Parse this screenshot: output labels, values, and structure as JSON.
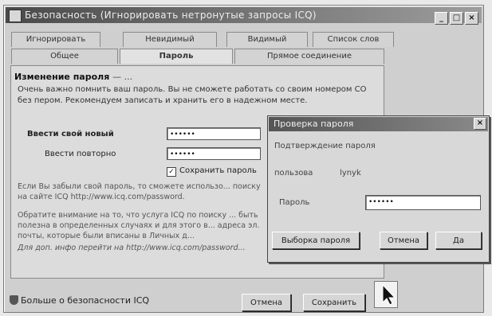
{
  "window": {
    "title": "Безопасность (Игнорировать нетронутые запросы ICQ)",
    "controls": [
      "_",
      "□",
      "×"
    ]
  },
  "tabs_top": [
    "Игнорировать",
    "Невидимый",
    "Видимый",
    "Список слов"
  ],
  "tabs_bottom": [
    "Общее",
    "Пароль",
    "Прямое соединение"
  ],
  "password_section": {
    "title": "Изменение пароля",
    "title_suffix": "— ...",
    "warning": "Очень важно помнить ваш пароль. Вы не сможете работать со своим номером СО без пером. Рекомендуем записать и хранить его в надежном месте.",
    "new_label": "Ввести свой новый",
    "repeat_label": "Ввести повторно",
    "new_value": "••••••",
    "repeat_value": "••••••",
    "save_password_label": "Сохранить пароль",
    "save_password_checked": true,
    "info_forgot": "Если Вы забыли свой пароль, то сможете использо... поиску на сайте ICQ http://www.icq.com/password.",
    "info_attention": "Обратите внимание на то, что услуга ICQ по поиску ... быть полезна в определенных случаях и для этого в... адреса эл. почты, которые были вписаны в Личных д...",
    "info_more": "Для доп. инфо перейти на http://www.icq.com/password..."
  },
  "footer": {
    "more_security_label": "Больше о безопасности ICQ",
    "cancel_label": "Отмена",
    "save_label": "Сохранить"
  },
  "dialog": {
    "title": "Проверка пароля",
    "close": "×",
    "subtitle": "Подтверждение пароля",
    "user_label": "пользова",
    "user_value": "lynyk",
    "password_label": "Пароль",
    "password_value": "••••••",
    "choose_label": "Выборка пароля",
    "cancel_label": "Отмена",
    "ok_label": "Да"
  }
}
